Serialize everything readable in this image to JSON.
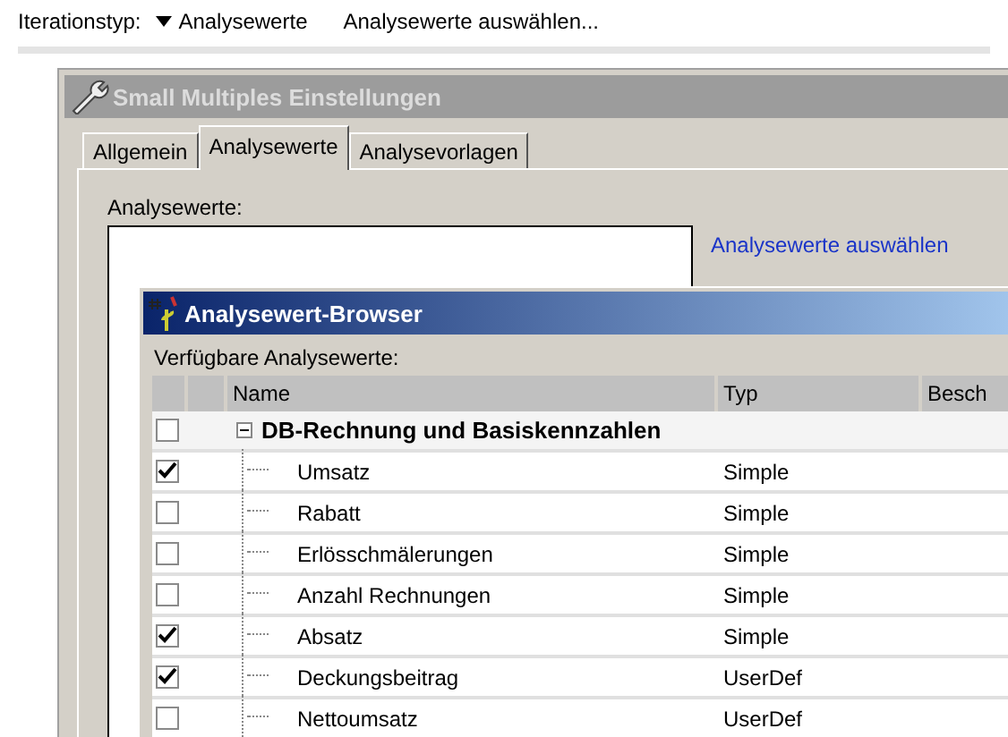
{
  "toolbar": {
    "label": "Iterationstyp:",
    "dropdown_value": "Analysewerte",
    "action": "Analysewerte auswählen..."
  },
  "settings_window": {
    "title": "Small Multiples Einstellungen",
    "tabs": [
      {
        "label": "Allgemein",
        "selected": false
      },
      {
        "label": "Analysewerte",
        "selected": true
      },
      {
        "label": "Analysevorlagen",
        "selected": false
      }
    ],
    "list_label": "Analysewerte:",
    "link": "Analysewerte auswählen"
  },
  "browser_window": {
    "title": "Analysewert-Browser",
    "list_label": "Verfügbare Analysewerte:",
    "columns": [
      "Name",
      "Typ",
      "Besch"
    ],
    "rows": [
      {
        "kind": "group",
        "checked": false,
        "expanded": true,
        "name": "DB-Rechnung und Basiskennzahlen"
      },
      {
        "kind": "item",
        "checked": true,
        "name": "Umsatz",
        "type": "Simple"
      },
      {
        "kind": "item",
        "checked": false,
        "name": "Rabatt",
        "type": "Simple"
      },
      {
        "kind": "item",
        "checked": false,
        "name": "Erlösschmälerungen",
        "type": "Simple"
      },
      {
        "kind": "item",
        "checked": false,
        "name": "Anzahl Rechnungen",
        "type": "Simple"
      },
      {
        "kind": "item",
        "checked": true,
        "name": "Absatz",
        "type": "Simple"
      },
      {
        "kind": "item",
        "checked": true,
        "name": "Deckungsbeitrag",
        "type": "UserDef"
      },
      {
        "kind": "item",
        "checked": false,
        "name": "Nettoumsatz",
        "type": "UserDef"
      }
    ]
  }
}
